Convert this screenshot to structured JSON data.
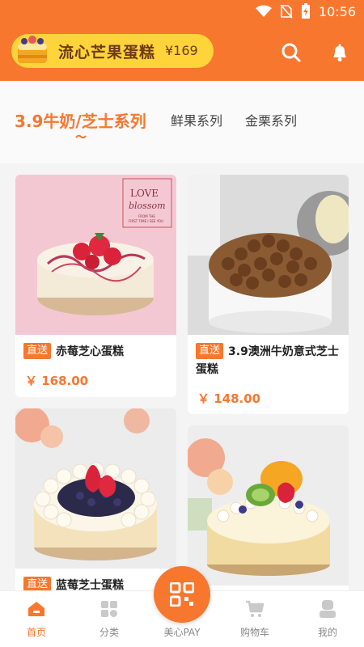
{
  "status_bar": {
    "time": "10:56"
  },
  "header": {
    "promo_name": "流心芒果蛋糕",
    "promo_price": "¥169",
    "search_icon": "search-icon",
    "bell_icon": "bell-icon"
  },
  "tabs": [
    {
      "label": "3.9牛奶/芝士系列",
      "active": true
    },
    {
      "label": "鲜果系列",
      "active": false
    },
    {
      "label": "金栗系列",
      "active": false
    }
  ],
  "products": [
    {
      "tag": "直送",
      "name": "赤莓芝心蛋糕",
      "price": "￥ 168.00",
      "image_text_1": "LOVE",
      "image_text_2": "blossom",
      "image_text_3": "FROM THE",
      "image_text_4": "FIRST TIME I SEE YOU"
    },
    {
      "tag": "直送",
      "name": "3.9澳洲牛奶意式芝士蛋糕",
      "price": "￥ 148.00"
    },
    {
      "tag": "直送",
      "name": "蓝莓芝士蛋糕"
    },
    {
      "tag": "",
      "name": ""
    }
  ],
  "bottom_nav": {
    "items": [
      {
        "label": "首页",
        "icon": "home-icon"
      },
      {
        "label": "分类",
        "icon": "category-icon"
      },
      {
        "label": "美心PAY",
        "icon": "qr-pay-icon"
      },
      {
        "label": "购物车",
        "icon": "cart-icon"
      },
      {
        "label": "我的",
        "icon": "profile-icon"
      }
    ]
  },
  "colors": {
    "brand": "#f7772e",
    "promo_bg": "#ffd43a"
  }
}
